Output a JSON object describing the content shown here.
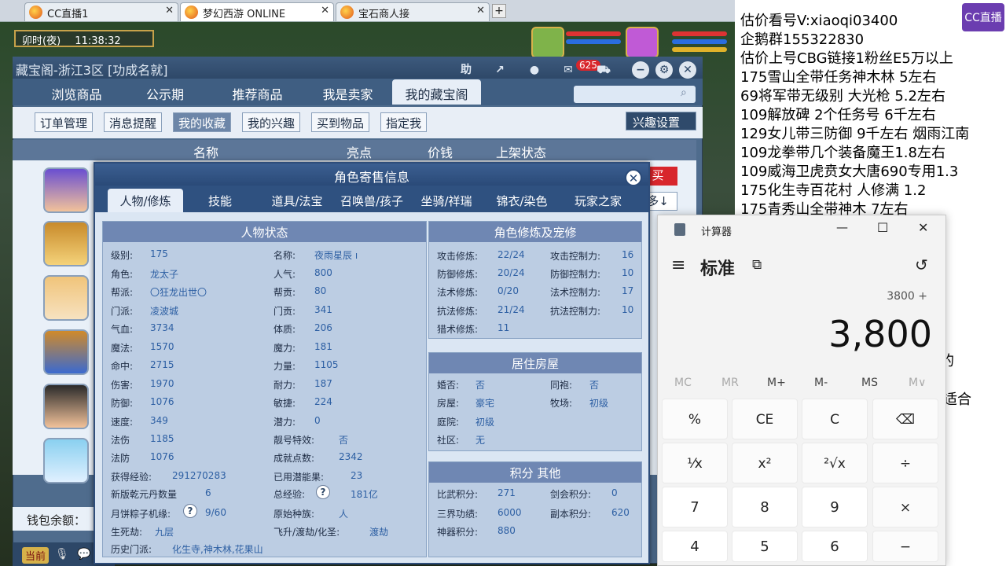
{
  "browser": {
    "tabs": [
      {
        "label": "CC直播1",
        "active": false
      },
      {
        "label": "梦幻西游 ONLINE",
        "active": true
      },
      {
        "label": "宝石商人接",
        "active": false
      }
    ],
    "close_glyph": "✕",
    "new_tab_glyph": "+"
  },
  "game": {
    "time_label": "卯时(夜)",
    "clock": "11:38:32",
    "window_title": "藏宝阁-浙江3区 [功成名就]",
    "help_label": "助",
    "message_count": "625",
    "nav_tabs": [
      "浏览商品",
      "公示期",
      "推荐商品",
      "我是卖家",
      "我的藏宝阁"
    ],
    "sub_buttons": [
      "订单管理",
      "消息提醒",
      "我的收藏",
      "我的兴趣",
      "买到物品",
      "指定我"
    ],
    "interest_settings": "兴趣设置",
    "columns": [
      "名称",
      "亮点",
      "价钱",
      "上架状态"
    ],
    "wallet_label": "钱包余额：",
    "buy_label": "买",
    "more_label": "多↓",
    "bottom_label": "当前"
  },
  "modal": {
    "title": "角色寄售信息",
    "tabs": [
      "人物/修炼",
      "技能",
      "道具/法宝",
      "召唤兽/孩子",
      "坐骑/祥瑞",
      "锦衣/染色",
      "玩家之家"
    ],
    "left_panel_title": "人物状态",
    "status_col1": [
      {
        "label": "级别:",
        "value": "175"
      },
      {
        "label": "角色:",
        "value": "龙太子"
      },
      {
        "label": "帮派:",
        "value": "〇狂龙出世〇"
      },
      {
        "label": "门派:",
        "value": "凌波城"
      },
      {
        "label": "气血:",
        "value": "3734"
      },
      {
        "label": "魔法:",
        "value": "1570"
      },
      {
        "label": "命中:",
        "value": "2715"
      },
      {
        "label": "伤害:",
        "value": "1970"
      },
      {
        "label": "防御:",
        "value": "1076"
      },
      {
        "label": "速度:",
        "value": "349"
      },
      {
        "label": "法伤",
        "value": "1185"
      },
      {
        "label": "法防",
        "value": "1076"
      },
      {
        "label": "获得经验:",
        "value": "291270283"
      },
      {
        "label": "新版乾元丹数量",
        "value": "6"
      },
      {
        "label": "月饼粽子机缘:",
        "value": "9/60"
      },
      {
        "label": "生死劫:",
        "value": "九层"
      },
      {
        "label": "历史门派:",
        "value": "化生寺,神木林,花果山"
      }
    ],
    "status_col2": [
      {
        "label": "名称:",
        "value": "夜雨星辰 ı"
      },
      {
        "label": "人气:",
        "value": "800"
      },
      {
        "label": "帮贡:",
        "value": "80"
      },
      {
        "label": "门贡:",
        "value": "341"
      },
      {
        "label": "体质:",
        "value": "206"
      },
      {
        "label": "魔力:",
        "value": "181"
      },
      {
        "label": "力量:",
        "value": "1105"
      },
      {
        "label": "耐力:",
        "value": "187"
      },
      {
        "label": "敏捷:",
        "value": "224"
      },
      {
        "label": "潜力:",
        "value": "0"
      },
      {
        "label": "靓号特效:",
        "value": "否"
      },
      {
        "label": "成就点数:",
        "value": "2342"
      },
      {
        "label": "已用潜能果:",
        "value": "23"
      },
      {
        "label": "总经验:",
        "value": "181亿"
      },
      {
        "label": "原始种族:",
        "value": "人"
      },
      {
        "label": "飞升/渡劫/化圣:",
        "value": "渡劫"
      }
    ],
    "right_panel_title": "角色修炼及宠修",
    "cultivation": [
      {
        "label": "攻击修炼:",
        "value": "22/24",
        "label2": "攻击控制力:",
        "value2": "16"
      },
      {
        "label": "防御修炼:",
        "value": "20/24",
        "label2": "防御控制力:",
        "value2": "10"
      },
      {
        "label": "法术修炼:",
        "value": "0/20",
        "label2": "法术控制力:",
        "value2": "17"
      },
      {
        "label": "抗法修炼:",
        "value": "21/24",
        "label2": "抗法控制力:",
        "value2": "10"
      },
      {
        "label": "猎术修炼:",
        "value": "11",
        "label2": "",
        "value2": ""
      }
    ],
    "house_title": "居住房屋",
    "house": [
      {
        "label": "婚否:",
        "value": "否",
        "label2": "同袍:",
        "value2": "否"
      },
      {
        "label": "房屋:",
        "value": "豪宅",
        "label2": "牧场:",
        "value2": "初级"
      },
      {
        "label": "庭院:",
        "value": "初级",
        "label2": "",
        "value2": ""
      },
      {
        "label": "社区:",
        "value": "无",
        "label2": "",
        "value2": ""
      }
    ],
    "score_title": "积分 其他",
    "scores": [
      {
        "label": "比武积分:",
        "value": "271",
        "label2": "剑会积分:",
        "value2": "0"
      },
      {
        "label": "三界功绩:",
        "value": "6000",
        "label2": "副本积分:",
        "value2": "620"
      },
      {
        "label": "神器积分:",
        "value": "880",
        "label2": "",
        "value2": ""
      }
    ],
    "help_glyph": "?"
  },
  "overlay_text": [
    "估价看号V:xiaoqi03400",
    "企鹅群155322830",
    "估价上号CBG链接1粉丝E5万以上",
    "175雪山全带任务神木林 5左右",
    "69将军带无级别 大光枪 5.2左右",
    "109解放碑 2个任务号 6千左右",
    "129女儿带三防御 9千左右 烟雨江南",
    "109龙拳带几个装备魔王1.8左右",
    "109威海卫虎贲女大唐690专用1.3",
    "175化生寺百花村 人修满 1.2",
    "175青秀山全带神木 7左右"
  ],
  "overlay_fragments": [
    "的",
    "适合"
  ],
  "cc_logo": "CC直播",
  "calculator": {
    "app_title": "计算器",
    "mode": "标准",
    "expression": "3800 +",
    "display": "3,800",
    "memory": [
      "MC",
      "MR",
      "M+",
      "M-",
      "MS",
      "M∨"
    ],
    "keys": [
      "%",
      "CE",
      "C",
      "⌫",
      "¹⁄x",
      "x²",
      "²√x",
      "÷",
      "7",
      "8",
      "9",
      "×",
      "4",
      "5",
      "6",
      "−"
    ],
    "minimize": "—",
    "maximize": "☐",
    "close": "✕",
    "menu_glyph": "≡",
    "keep_on_top_glyph": "⧉",
    "history_glyph": "↺"
  }
}
